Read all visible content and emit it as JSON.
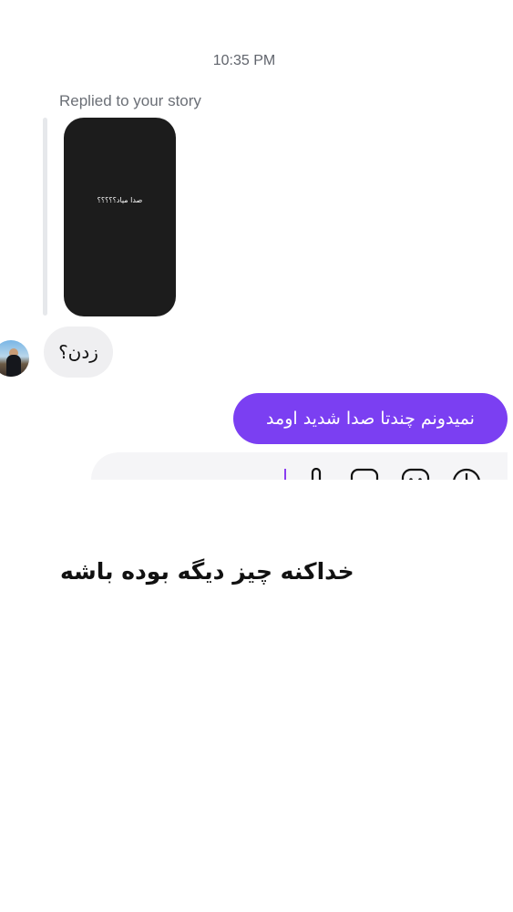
{
  "chat": {
    "timestamp": "10:35 PM",
    "replied_label": "Replied to your story",
    "story_text": "صدا میاد؟؟؟؟؟",
    "incoming_message": "زدن؟",
    "outgoing_message": "نمیدونم چندتا صدا شدید اومد"
  },
  "composer": {
    "icons": [
      "microphone-icon",
      "photo-icon",
      "sticker-icon",
      "plus-icon"
    ],
    "accent": "#7b3ff2"
  },
  "caption": {
    "text": "خداکنه چیز دیگه بوده باشه"
  },
  "colors": {
    "outgoing_bubble": "#7b3ff2",
    "incoming_bubble": "#efeff1",
    "story_background": "#1c1c1c"
  }
}
